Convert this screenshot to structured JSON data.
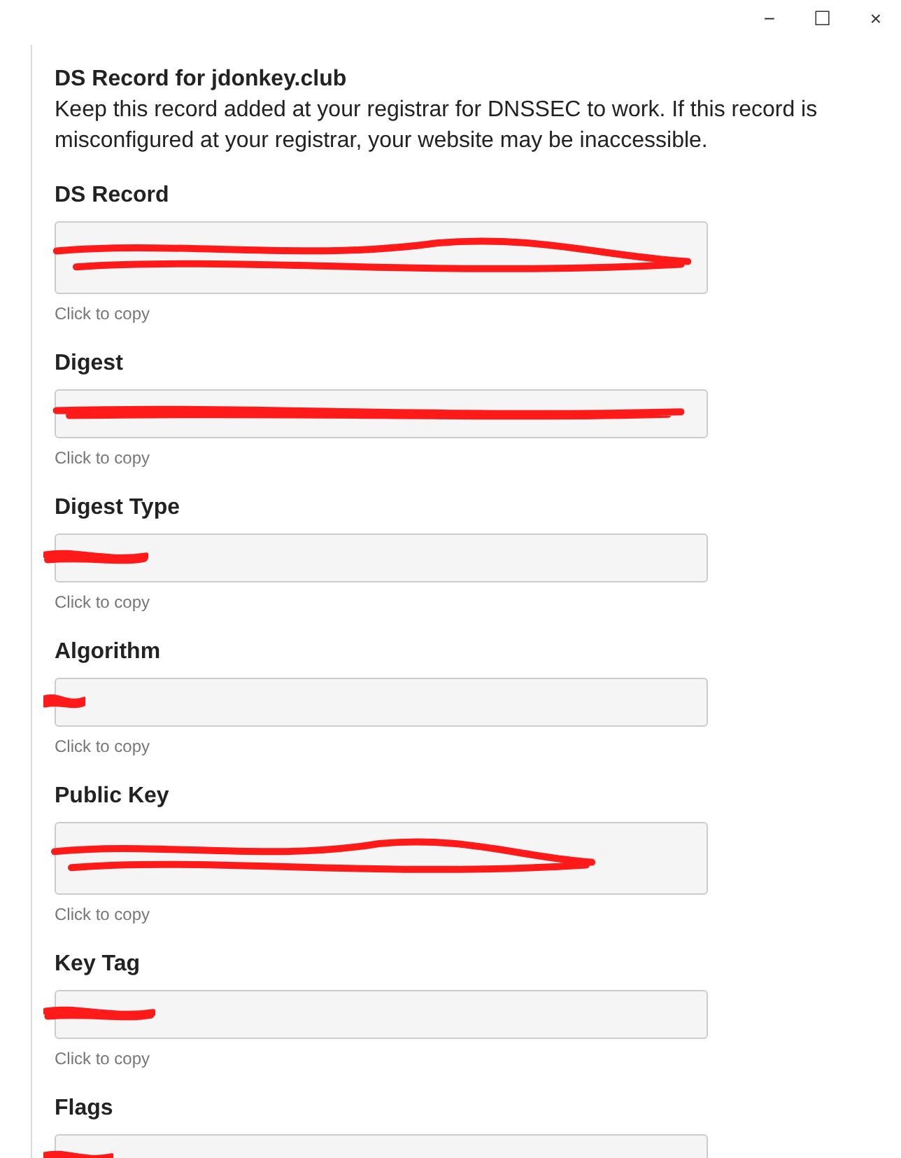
{
  "window": {
    "controls": [
      "−",
      "☐",
      "×"
    ]
  },
  "header": {
    "title": "DS Record for jdonkey.club",
    "description": "Keep this record added at your registrar for DNSSEC to work. If this record is misconfigured at your registrar, your website may be inaccessible."
  },
  "fields": [
    {
      "label": "DS Record",
      "kind": "multiline",
      "redacted": true,
      "hint": "Click to copy"
    },
    {
      "label": "Digest",
      "kind": "single",
      "redacted": true,
      "hint": "Click to copy"
    },
    {
      "label": "Digest Type",
      "kind": "single",
      "redacted": true,
      "hint": "Click to copy"
    },
    {
      "label": "Algorithm",
      "kind": "single",
      "redacted": true,
      "hint": "Click to copy"
    },
    {
      "label": "Public Key",
      "kind": "multiline",
      "redacted": true,
      "hint": "Click to copy"
    },
    {
      "label": "Key Tag",
      "kind": "single",
      "redacted": true,
      "hint": "Click to copy"
    },
    {
      "label": "Flags",
      "kind": "single",
      "redacted": true
    }
  ]
}
